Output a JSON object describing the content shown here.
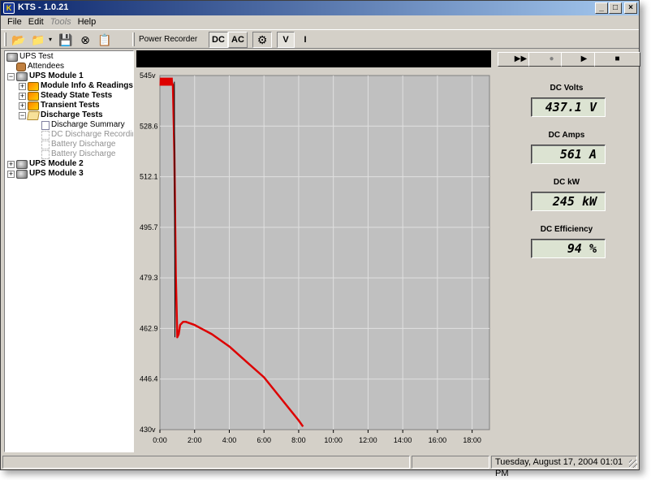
{
  "window": {
    "title": "KTS - 1.0.21",
    "app_icon": "kts-logo-icon"
  },
  "menu": [
    "File",
    "Edit",
    "Tools",
    "Help"
  ],
  "toolbar": {
    "label": "Power Recorder",
    "dc": "DC",
    "ac": "AC",
    "v": "V",
    "i": "I",
    "icons": [
      "new-icon",
      "open-icon",
      "save-icon",
      "stop-icon",
      "report-icon",
      "settings-icon"
    ]
  },
  "tree": [
    {
      "label": "UPS Test",
      "style": "normal"
    },
    {
      "label": "Attendees",
      "style": "normal"
    },
    {
      "label": "UPS Module 1",
      "style": "bold",
      "exp": "−"
    },
    {
      "label": "Module Info & Readings",
      "style": "bold",
      "exp": "+"
    },
    {
      "label": "Steady State Tests",
      "style": "bold",
      "exp": "+"
    },
    {
      "label": "Transient Tests",
      "style": "bold",
      "exp": "+"
    },
    {
      "label": "Discharge Tests",
      "style": "bold",
      "exp": "−"
    },
    {
      "label": "Discharge Summary",
      "style": "normal"
    },
    {
      "label": "DC Discharge Recording",
      "style": "grey"
    },
    {
      "label": "Battery Discharge",
      "style": "grey"
    },
    {
      "label": "Battery Discharge",
      "style": "grey"
    },
    {
      "label": "UPS Module 2",
      "style": "bold",
      "exp": "+"
    },
    {
      "label": "UPS Module 3",
      "style": "bold",
      "exp": "+"
    }
  ],
  "controls": {
    "fast_forward": "▶▶",
    "record": "●",
    "play": "▶",
    "stop": "■"
  },
  "meters": [
    {
      "label": "DC Volts",
      "value": "437.1 V"
    },
    {
      "label": "DC Amps",
      "value": "561 A"
    },
    {
      "label": "DC kW",
      "value": "245 kW"
    },
    {
      "label": "DC Efficiency",
      "value": "94 %"
    }
  ],
  "status": {
    "datetime": "Tuesday, August 17, 2004  01:01 PM"
  },
  "colors": {
    "trace": "#dd0000",
    "plot_bg": "#c0c0c0",
    "grid": "#e0e0e0"
  },
  "chart_data": {
    "type": "line",
    "x_ticks": [
      "0:00",
      "2:00",
      "4:00",
      "6:00",
      "8:00",
      "10:00",
      "12:00",
      "14:00",
      "16:00",
      "18:00"
    ],
    "y_ticks": [
      "545v",
      "528.6",
      "512.1",
      "495.7",
      "479.3",
      "462.9",
      "446.4",
      "430v"
    ],
    "xlim_minutes": [
      0,
      1140
    ],
    "ylim": [
      430,
      545
    ],
    "series": [
      {
        "x_minutes": [
          0,
          10,
          20,
          30,
          40,
          45,
          50,
          55,
          60,
          65,
          70,
          80,
          90,
          120,
          180,
          240,
          300,
          360,
          420,
          480,
          495
        ],
        "y": [
          543,
          543,
          543,
          543,
          543,
          542,
          520,
          480,
          460,
          461,
          464,
          465,
          465,
          464,
          461,
          457,
          452,
          447,
          440,
          433,
          431
        ]
      }
    ]
  }
}
